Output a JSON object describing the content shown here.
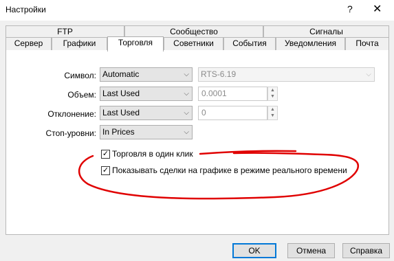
{
  "window": {
    "title": "Настройки",
    "help": "?",
    "close": "✕"
  },
  "tabs_row1": [
    "FTP",
    "Сообщество",
    "Сигналы"
  ],
  "tabs_row2": [
    "Сервер",
    "Графики",
    "Торговля",
    "Советники",
    "События",
    "Уведомления",
    "Почта"
  ],
  "active_tab": "Торговля",
  "form": {
    "symbol": {
      "label": "Символ:",
      "value": "Automatic",
      "field_value": "RTS-6.19"
    },
    "volume": {
      "label": "Объем:",
      "value": "Last Used",
      "field_value": "0.0001"
    },
    "deviation": {
      "label": "Отклонение:",
      "value": "Last Used",
      "field_value": "0"
    },
    "stop_levels": {
      "label": "Стоп-уровни:",
      "value": "In Prices"
    }
  },
  "checkboxes": {
    "one_click": {
      "label": "Торговля в один клик",
      "checked": true
    },
    "realtime_deals": {
      "label": "Показывать сделки на графике в режиме реального времени",
      "checked": true
    }
  },
  "buttons": {
    "ok": "OK",
    "cancel": "Отмена",
    "help": "Справка"
  },
  "colors": {
    "annotation": "#e00000",
    "default_border": "#0078d7"
  }
}
